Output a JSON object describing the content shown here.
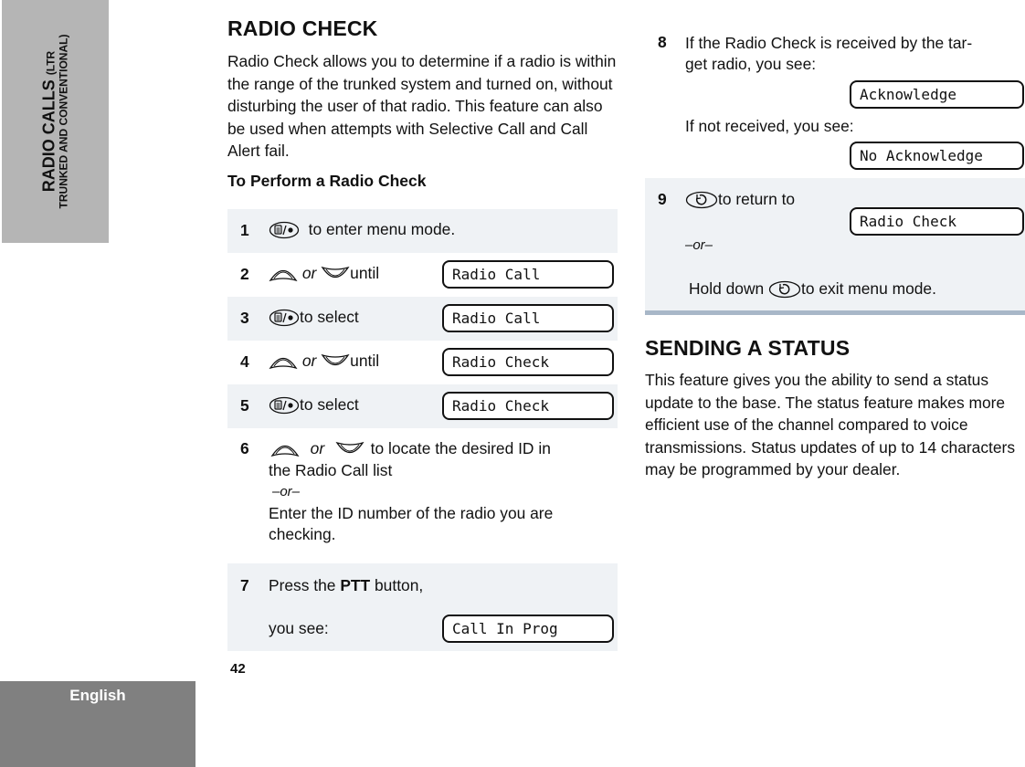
{
  "side_tab": {
    "title": "RADIO CALLS",
    "title_suffix": "(LTR",
    "subtitle": "TRUNKED AND CONVENTIONAL)"
  },
  "language_tab": "English",
  "page_number": "42",
  "radio_check": {
    "heading": "RADIO CHECK",
    "intro": "Radio Check allows you to determine if a radio is within the range of the trunked system and turned on, without disturbing the user of that radio. This feature can also be used when attempts with Selective Call and Call Alert fail.",
    "procedure_heading": "To Perform a Radio Check",
    "or_word": "or",
    "or_separator": "–or–",
    "steps": [
      {
        "number": "1",
        "icon": "menu-select-button-icon",
        "text": "to enter menu mode."
      },
      {
        "number": "2",
        "icon": "up-down-arrow-icons",
        "text": "until",
        "display": "Radio Call"
      },
      {
        "number": "3",
        "icon": "menu-select-button-icon",
        "text": "to select",
        "display": "Radio Call"
      },
      {
        "number": "4",
        "icon": "up-down-arrow-icons",
        "text": "until",
        "display": "Radio Check"
      },
      {
        "number": "5",
        "icon": "menu-select-button-icon",
        "text": "to select",
        "display": "Radio Check"
      },
      {
        "number": "6",
        "icon": "up-down-arrow-icons",
        "text_line1": "to locate the desired ID in",
        "text_line2": "the Radio Call list",
        "alt_line1": "Enter the ID number of the radio you are",
        "alt_line2": "checking."
      },
      {
        "number": "7",
        "text_pre": "Press the",
        "text_bold": "PTT",
        "text_post": "button,",
        "text_line2": "you see:",
        "display": "Call In Prog"
      },
      {
        "number": "8",
        "text_line1": "If the Radio Check is received by the tar-",
        "text_line2": "get radio, you see:",
        "display": "Acknowledge",
        "alt_text": "If not received, you see:",
        "alt_display": "No Acknowledge"
      },
      {
        "number": "9",
        "icon": "home-button-icon",
        "text": "to return to",
        "display": "Radio Check",
        "alt_pre": "Hold down",
        "alt_post": "to exit menu mode."
      }
    ]
  },
  "sending_status": {
    "heading": "SENDING A STATUS",
    "body": "This feature gives you the ability to send a status update to the base. The status feature makes more efficient use of the channel compared to voice transmissions. Status updates of up to 14 characters may be programmed by your dealer."
  }
}
